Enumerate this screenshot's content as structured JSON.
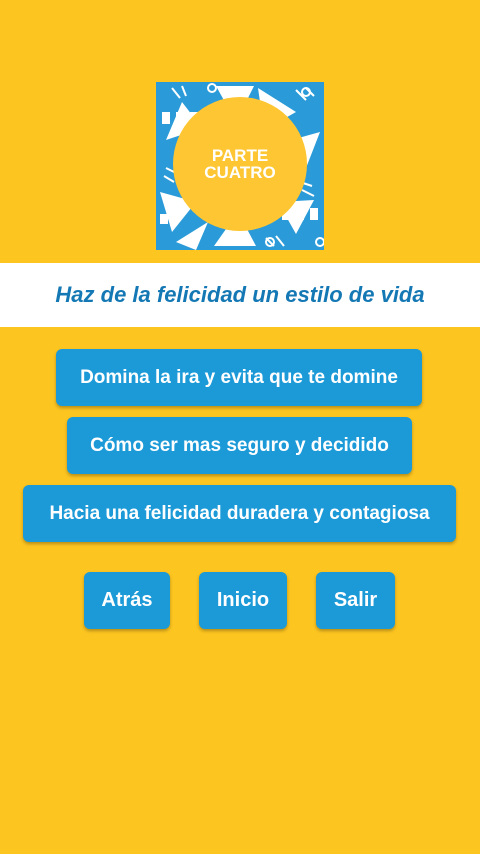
{
  "logo": {
    "line1": "PARTE",
    "line2": "CUATRO",
    "background_color": "#2A9BD8",
    "circle_color": "#FDC632"
  },
  "header": {
    "title": "Haz de la felicidad un estilo de vida"
  },
  "menu": {
    "items": [
      {
        "label": "Domina la ira y evita que te domine"
      },
      {
        "label": "Cómo ser mas seguro y decidido"
      },
      {
        "label": "Hacia una felicidad duradera y contagiosa"
      }
    ]
  },
  "nav": {
    "back": "Atrás",
    "home": "Inicio",
    "exit": "Salir"
  },
  "colors": {
    "background": "#FDC520",
    "button": "#1C9AD8",
    "title": "#1478B4"
  }
}
